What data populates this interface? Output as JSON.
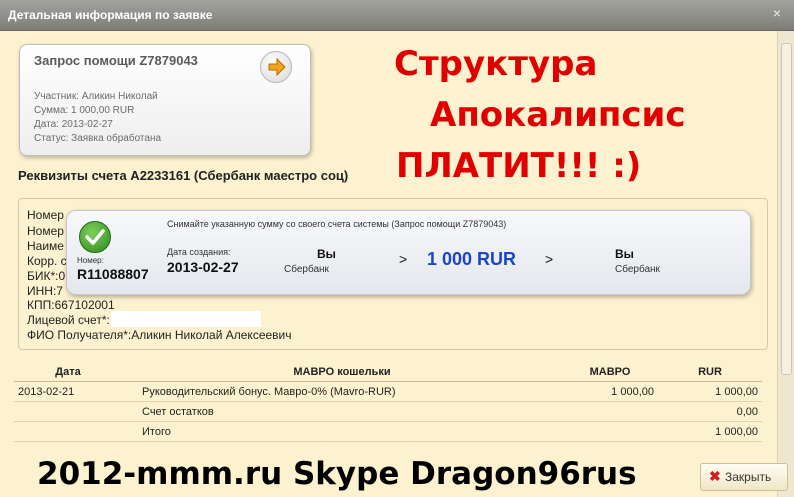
{
  "window": {
    "title": "Детальная информация по заявке",
    "close_glyph": "×"
  },
  "request_card": {
    "title": "Запрос помощи Z7879043",
    "participant": "Участник: Аликин Николай",
    "amount": "Сумма: 1 000,00 RUR",
    "date": "Дата: 2013-02-27",
    "status": "Статус: Заявка обработана",
    "arrow_icon": "arrow-right-icon"
  },
  "overlay_text": {
    "line1": "Структура",
    "line2": "Апокалипсис",
    "line3": "ПЛАТИТ!!! :)"
  },
  "requisites": {
    "title": "Реквизиты счета A2233161 (Сбербанк маестро соц)",
    "rows": [
      "Номер",
      "Номер",
      "Наиме",
      "Корр. с",
      "БИК*:0",
      "ИНН:7",
      "КПП:667102001",
      "Лицевой счет*:",
      "ФИО Получателя*:Аликин Николай Алексеевич"
    ]
  },
  "transfer_popup": {
    "description": "Снимайте указанную сумму со своего счета системы (Запрос помощи Z7879043)",
    "number_label": "Номер:",
    "number": "R11088807",
    "date_label": "Дата создания:",
    "date": "2013-02-27",
    "from_name": "Вы",
    "from_bank": "Сбербанк",
    "separator": ">",
    "amount": "1 000 RUR",
    "to_name": "Вы",
    "to_bank": "Сбербанк"
  },
  "table": {
    "headers": [
      "Дата",
      "МАВРО кошельки",
      "МАВРО",
      "RUR"
    ],
    "rows": [
      [
        "2013-02-21",
        "Руководительский бонус. Мавро-0% (Mavro-RUR)",
        "1 000,00",
        "1 000,00"
      ],
      [
        "",
        "Счет остатков",
        "",
        "0,00"
      ],
      [
        "",
        "Итого",
        "",
        "1 000,00"
      ]
    ]
  },
  "watermark": "2012-mmm.ru Skype Dragon96rus",
  "footer": {
    "close_label": "Закрыть"
  }
}
